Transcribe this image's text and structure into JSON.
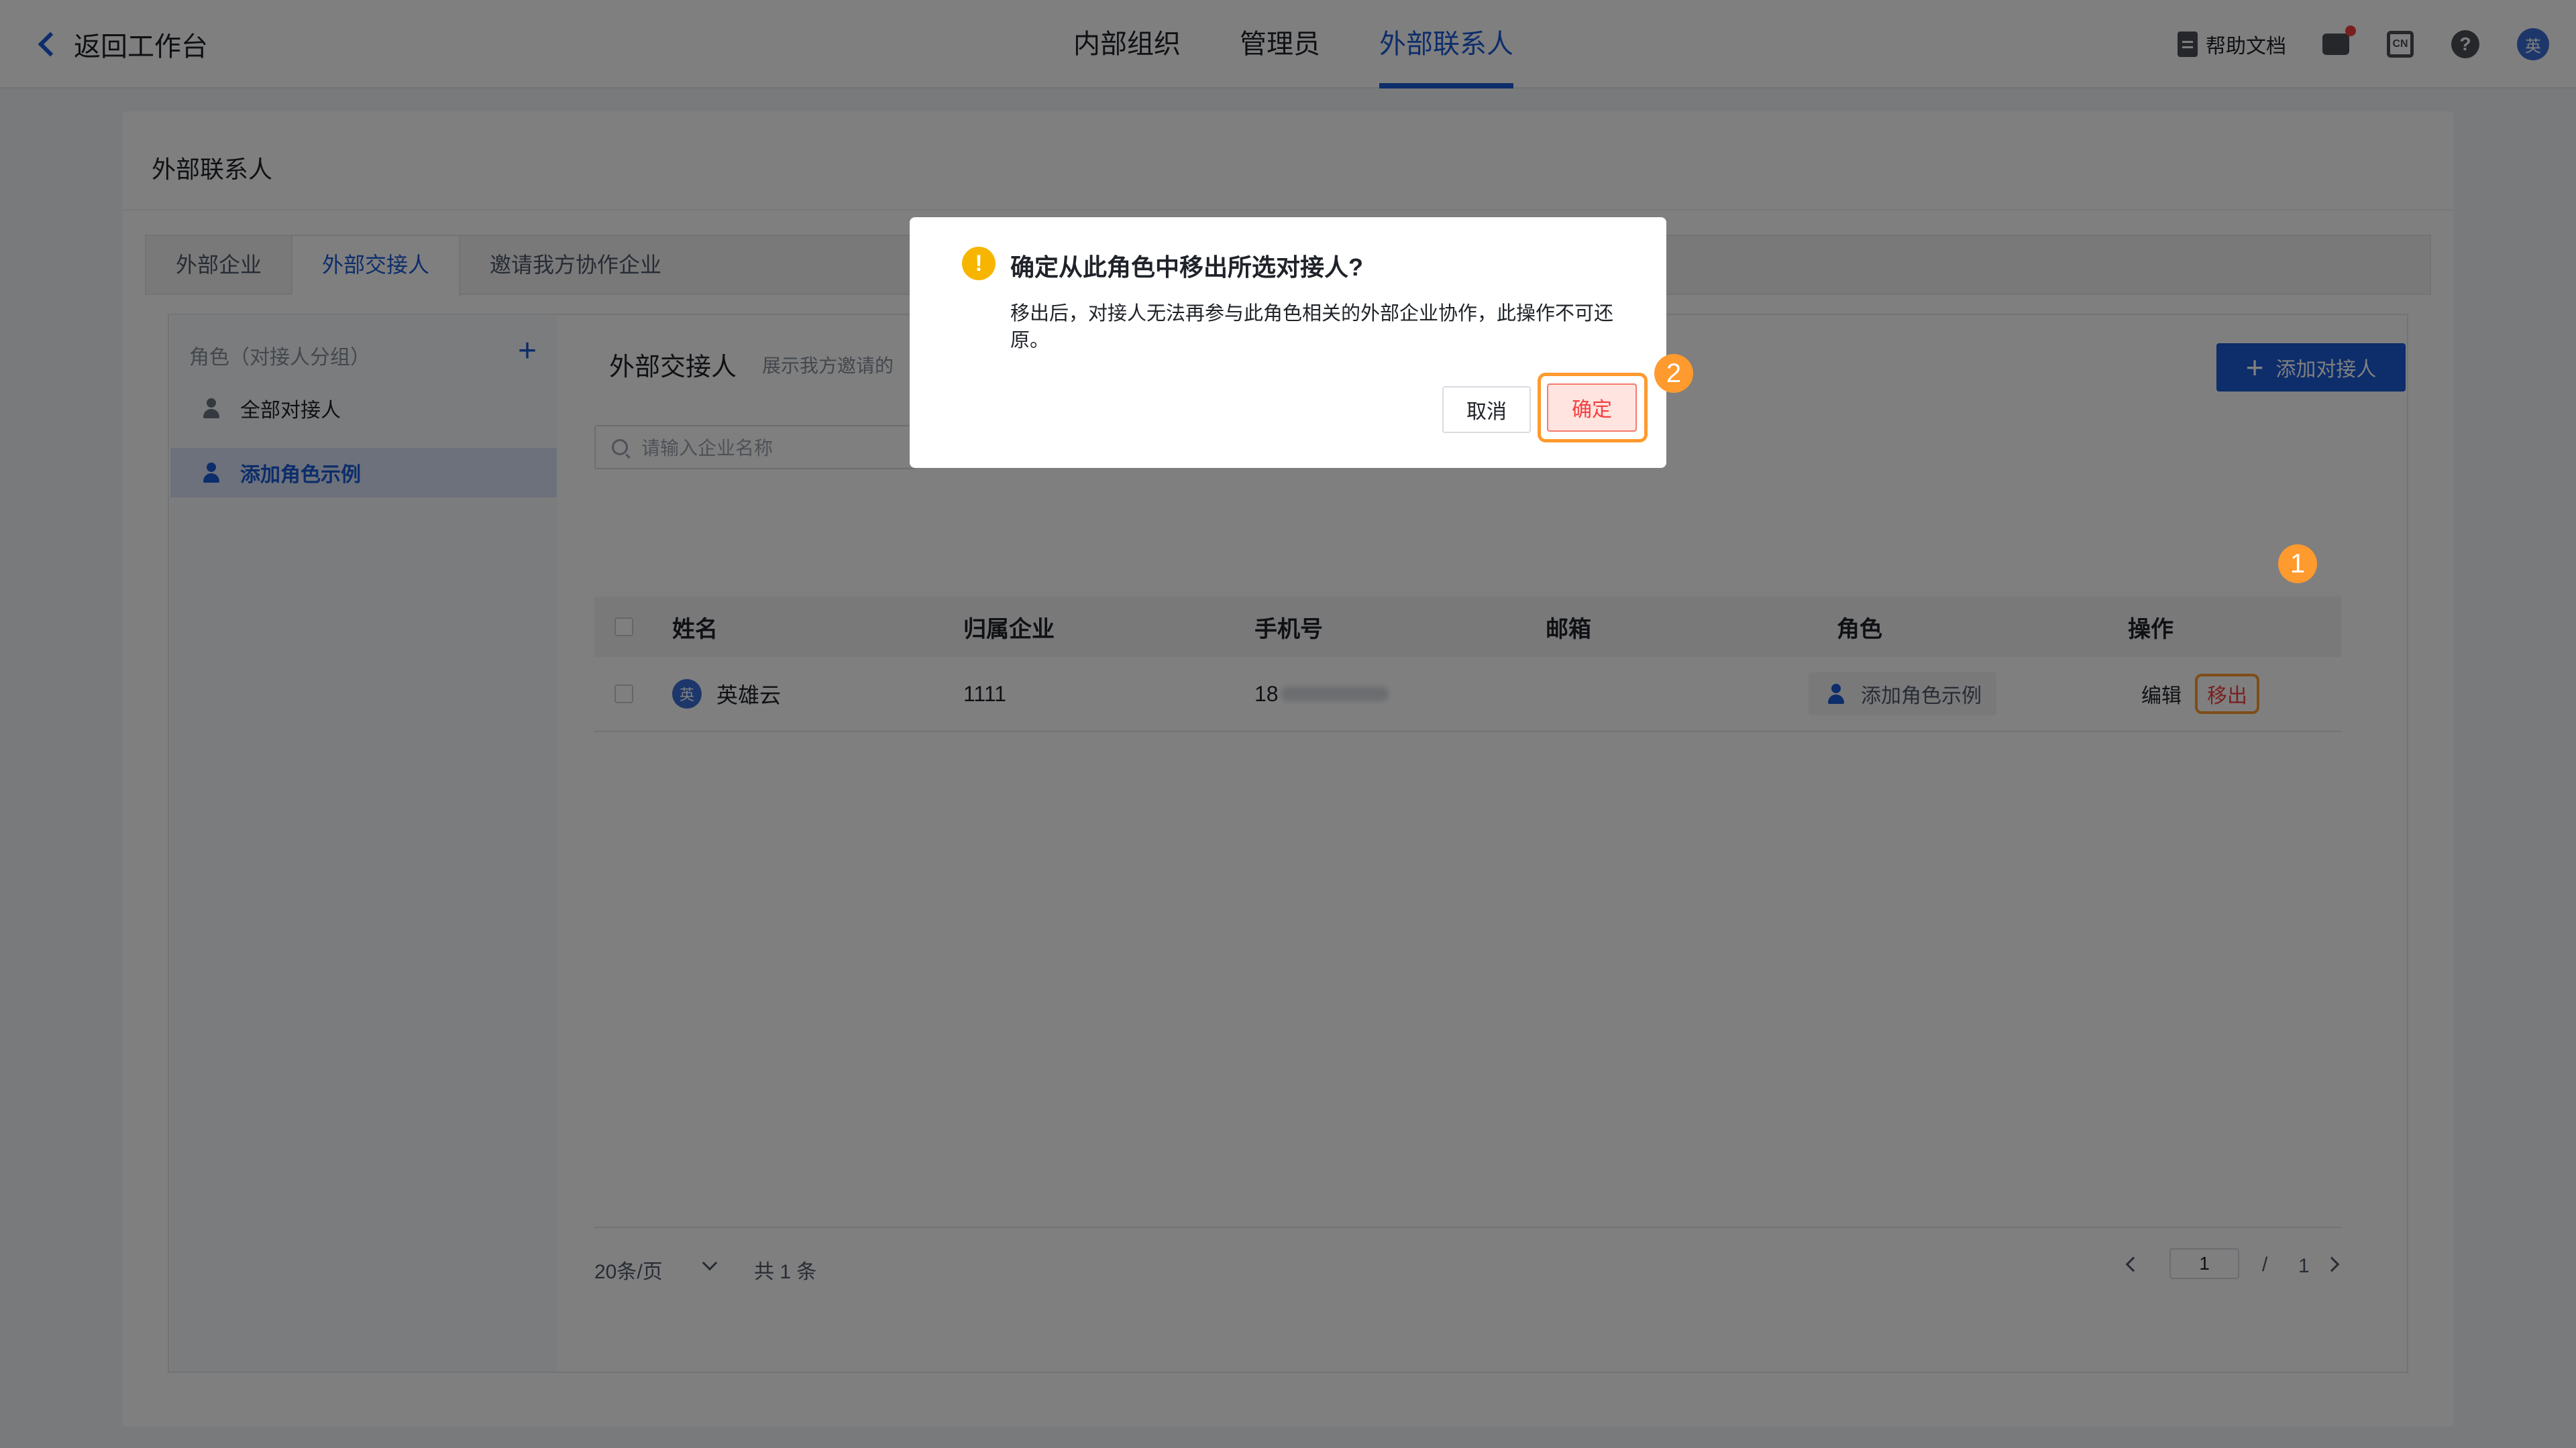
{
  "topbar": {
    "back_label": "返回工作台",
    "nav_tabs": [
      {
        "label": "内部组织",
        "active": false
      },
      {
        "label": "管理员",
        "active": false
      },
      {
        "label": "外部联系人",
        "active": true
      }
    ],
    "help_doc_label": "帮助文档",
    "lang_label": "CN",
    "help_q": "?",
    "avatar_text": "英",
    "icons": [
      "doc-icon",
      "message-icon",
      "language-icon",
      "help-icon",
      "avatar"
    ]
  },
  "card": {
    "title": "外部联系人",
    "subtabs": [
      {
        "label": "外部企业",
        "active": false
      },
      {
        "label": "外部交接人",
        "active": true
      },
      {
        "label": "邀请我方协作企业",
        "active": false
      }
    ]
  },
  "sidebar": {
    "header": "角色（对接人分组）",
    "add_symbol": "+",
    "items": [
      {
        "label": "全部对接人",
        "selected": false
      },
      {
        "label": "添加角色示例",
        "selected": true
      }
    ]
  },
  "panel": {
    "title": "外部交接人",
    "description": "展示我方邀请的",
    "add_button": "添加对接人",
    "search_placeholder": "请输入企业名称",
    "columns": [
      "姓名",
      "归属企业",
      "手机号",
      "邮箱",
      "角色",
      "操作"
    ],
    "rows": [
      {
        "avatar": "英",
        "name": "英雄云",
        "company": "1111",
        "phone_prefix": "18",
        "email": "",
        "role": "添加角色示例",
        "actions": {
          "edit": "编辑",
          "remove": "移出"
        }
      }
    ]
  },
  "pagination": {
    "page_size": "20条/页",
    "total": "共 1 条",
    "current_page": "1",
    "slash": "/",
    "total_pages": "1"
  },
  "modal": {
    "icon": "!",
    "title": "确定从此角色中移出所选对接人?",
    "body": "移出后，对接人无法再参与此角色相关的外部企业协作，此操作不可还原。",
    "cancel": "取消",
    "confirm": "确定"
  },
  "annotations": {
    "step1": "1",
    "step2": "2"
  },
  "colors": {
    "primary": "#1a5bd6",
    "danger": "#f53f3f",
    "highlight": "#ff9a2e",
    "warning": "#f7b500"
  }
}
